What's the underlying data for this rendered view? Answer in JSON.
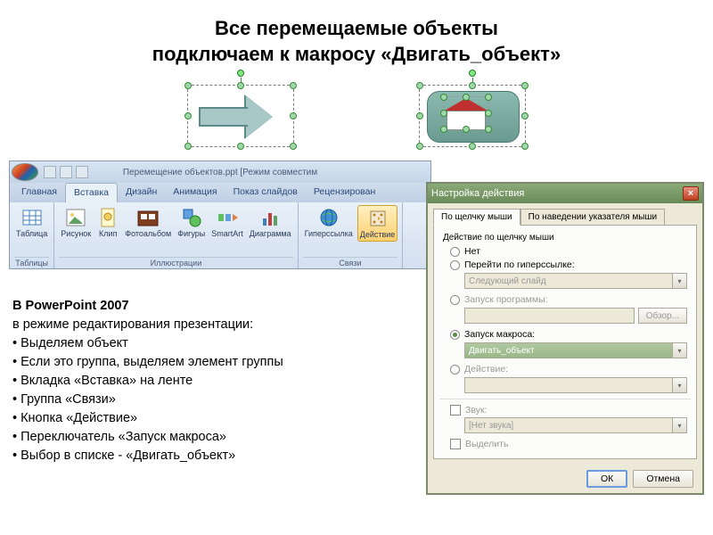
{
  "title_line1": "Все перемещаемые объекты",
  "title_line2": "подключаем к макросу «Двигать_объект»",
  "ribbon": {
    "window_title": "Перемещение объектов.ppt [Режим совместим",
    "tabs": [
      "Главная",
      "Вставка",
      "Дизайн",
      "Анимация",
      "Показ слайдов",
      "Рецензирован"
    ],
    "active_tab": 1,
    "groups": {
      "tables": {
        "name": "Таблицы",
        "items": [
          {
            "label": "Таблица"
          }
        ]
      },
      "illustrations": {
        "name": "Иллюстрации",
        "items": [
          {
            "label": "Рисунок"
          },
          {
            "label": "Клип"
          },
          {
            "label": "Фотоальбом"
          },
          {
            "label": "Фигуры"
          },
          {
            "label": "SmartArt"
          },
          {
            "label": "Диаграмма"
          }
        ]
      },
      "links": {
        "name": "Связи",
        "items": [
          {
            "label": "Гиперссылка"
          },
          {
            "label": "Действие",
            "highlighted": true
          }
        ]
      }
    }
  },
  "dialog": {
    "title": "Настройка действия",
    "tabs": [
      "По щелчку мыши",
      "По наведении указателя мыши"
    ],
    "active_tab": 0,
    "group_label": "Действие по щелчку мыши",
    "options": {
      "none": "Нет",
      "hyperlink": "Перейти по гиперссылке:",
      "hyperlink_value": "Следующий слайд",
      "run_program": "Запуск программы:",
      "browse": "Обзор...",
      "run_macro": "Запуск макроса:",
      "macro_value": "Двигать_объект",
      "object_action": "Действие:"
    },
    "selected": "run_macro",
    "sound_check": "Звук:",
    "sound_value": "[Нет звука]",
    "highlight_check": "Выделить",
    "ok": "ОК",
    "cancel": "Отмена"
  },
  "instructions": {
    "heading": "В PowerPoint 2007",
    "lines": [
      "в режиме редактирования презентации:",
      "• Выделяем объект",
      "• Если это группа, выделяем элемент группы",
      "• Вкладка «Вставка» на ленте",
      "• Группа «Связи»",
      "• Кнопка «Действие»",
      "• Переключатель «Запуск макроса»",
      "• Выбор в списке - «Двигать_объект»"
    ]
  }
}
